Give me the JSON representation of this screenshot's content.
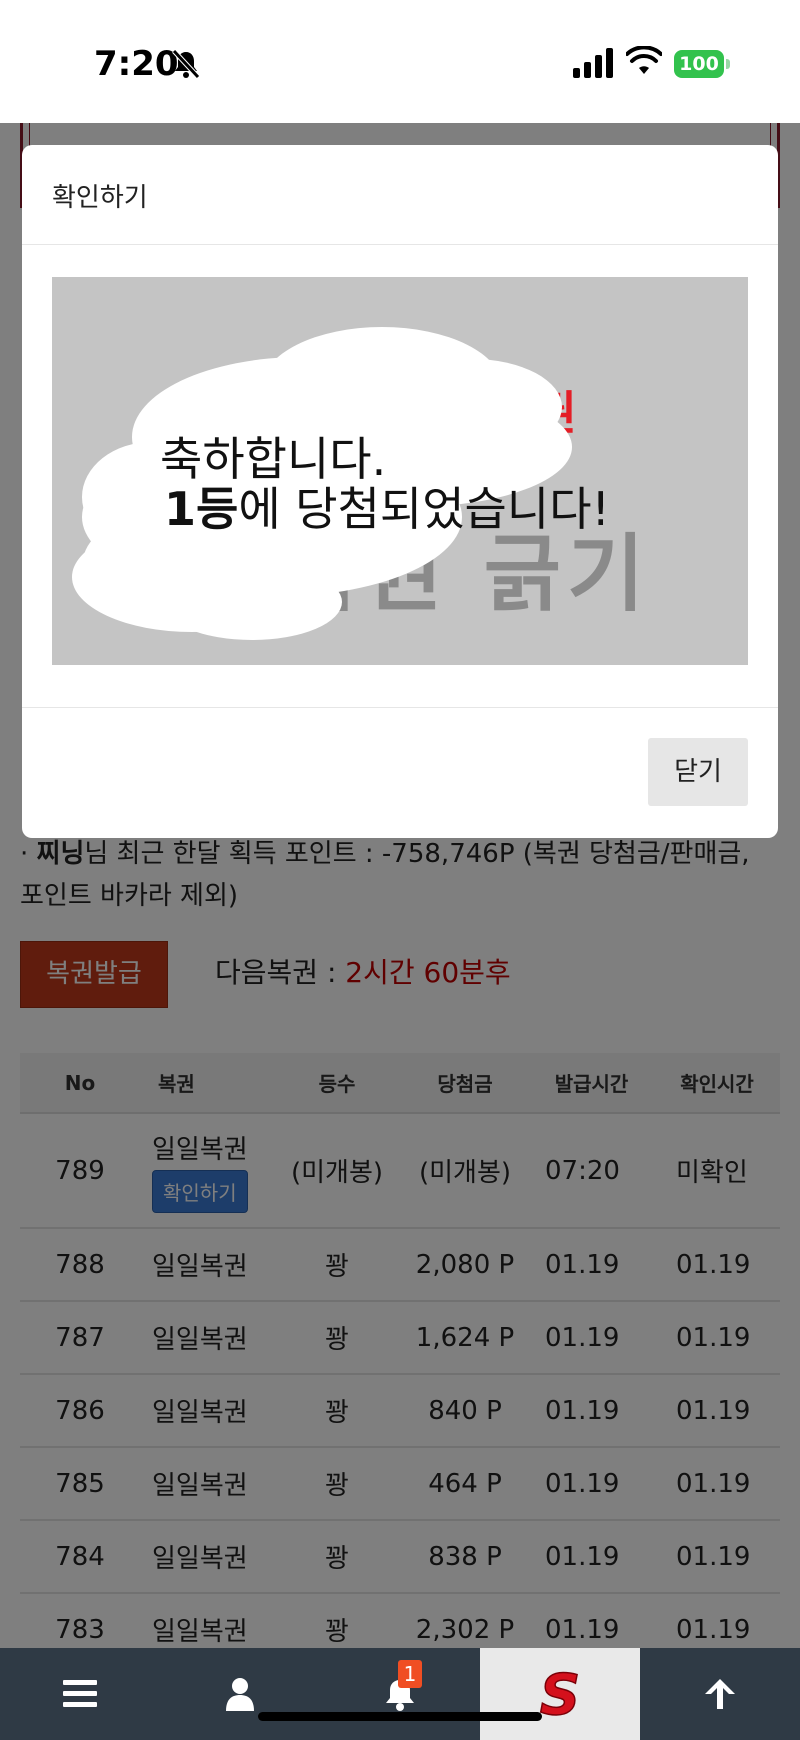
{
  "status_bar": {
    "time": "7:20",
    "battery": "100"
  },
  "modal": {
    "title": "확인하기",
    "scratch_bg_text": "복권 긁기",
    "win_line1": "축하합니다.",
    "win_rank": "1등",
    "win_line2_rest": "에 당첨되었습니다!",
    "close_label": "닫기"
  },
  "info": {
    "prefix": "· ",
    "user": "찌닝",
    "text": "님 최근 한달 획득 포인트 : -758,746P (복권 당첨금/판매금, 포인트 바카라 제외)"
  },
  "issue_button": "복권발급",
  "next_lotto": {
    "label": "다음복권 : ",
    "time": "2시간 60분후"
  },
  "table": {
    "headers": [
      "No",
      "복권",
      "등수",
      "당첨금",
      "발급시간",
      "확인시간"
    ],
    "confirm_button": "확인하기",
    "rows": [
      {
        "no": "789",
        "lotto": "일일복권",
        "rank": "(미개봉)",
        "prize": "(미개봉)",
        "issued": "07:20",
        "checked": "미확인"
      },
      {
        "no": "788",
        "lotto": "일일복권",
        "rank": "꽝",
        "prize": "2,080 P",
        "issued": "01.19",
        "checked": "01.19"
      },
      {
        "no": "787",
        "lotto": "일일복권",
        "rank": "꽝",
        "prize": "1,624 P",
        "issued": "01.19",
        "checked": "01.19"
      },
      {
        "no": "786",
        "lotto": "일일복권",
        "rank": "꽝",
        "prize": "840 P",
        "issued": "01.19",
        "checked": "01.19"
      },
      {
        "no": "785",
        "lotto": "일일복권",
        "rank": "꽝",
        "prize": "464 P",
        "issued": "01.19",
        "checked": "01.19"
      },
      {
        "no": "784",
        "lotto": "일일복권",
        "rank": "꽝",
        "prize": "838 P",
        "issued": "01.19",
        "checked": "01.19"
      },
      {
        "no": "783",
        "lotto": "일일복권",
        "rank": "꽝",
        "prize": "2,302 P",
        "issued": "01.19",
        "checked": "01.19"
      }
    ]
  },
  "bottom_nav": {
    "items": [
      "menu-icon",
      "user-icon",
      "bell-icon",
      "logo",
      "arrow-up-icon"
    ],
    "notification_count": "1"
  },
  "colors": {
    "accent_red": "#c00000",
    "issue_button": "#c0391b",
    "unchecked": "#d68a00",
    "nav_bg": "#2f3a45",
    "confirm_button": "#3a7bd5"
  }
}
